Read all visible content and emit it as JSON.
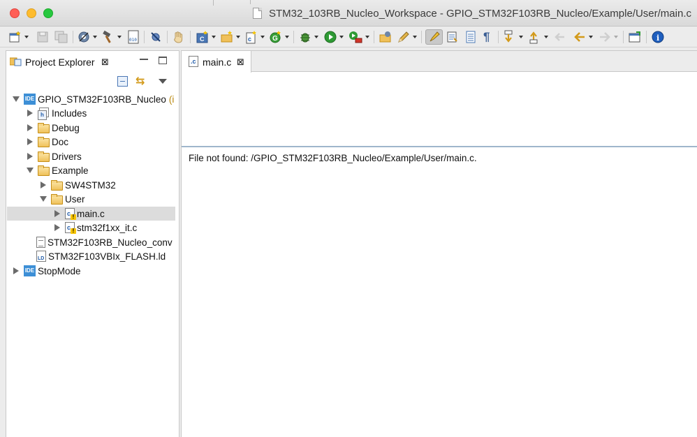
{
  "window": {
    "title": "STM32_103RB_Nucleo_Workspace - GPIO_STM32F103RB_Nucleo/Example/User/main.c"
  },
  "toolbar": {
    "buttons": [
      "new",
      "save",
      "save-all",
      "build-target",
      "build",
      "debug-config",
      "skip-breakpoints",
      "step",
      "new-c-project",
      "new-source-folder",
      "new-class",
      "run-external",
      "debug",
      "run",
      "run-last",
      "open-type",
      "open-task",
      "highlight",
      "mark-occurrences",
      "show-whitespace",
      "pilcrow",
      "next-annotation",
      "prev-annotation",
      "back",
      "forward",
      "perspective",
      "info"
    ]
  },
  "left_view": {
    "title": "Project Explorer",
    "close_glyph": "⊠",
    "tree": [
      {
        "label": "GPIO_STM32F103RB_Nucleo",
        "suffix": "(i",
        "level": 0,
        "expand": "down",
        "icon": "ide-project-icon"
      },
      {
        "label": "Includes",
        "level": 1,
        "expand": "right",
        "icon": "includes-icon"
      },
      {
        "label": "Debug",
        "level": 1,
        "expand": "right",
        "icon": "folder-icon"
      },
      {
        "label": "Doc",
        "level": 1,
        "expand": "right",
        "icon": "folder-icon"
      },
      {
        "label": "Drivers",
        "level": 1,
        "expand": "right",
        "icon": "folder-icon"
      },
      {
        "label": "Example",
        "level": 1,
        "expand": "down",
        "icon": "folder-open-icon"
      },
      {
        "label": "SW4STM32",
        "level": 2,
        "expand": "right",
        "icon": "folder-icon"
      },
      {
        "label": "User",
        "level": 2,
        "expand": "down",
        "icon": "folder-open-icon"
      },
      {
        "label": "main.c",
        "level": 3,
        "expand": "right",
        "icon": "c-file-warning-icon",
        "selected": true
      },
      {
        "label": "stm32f1xx_it.c",
        "level": 3,
        "expand": "right",
        "icon": "c-file-warning-icon"
      },
      {
        "label": "STM32F103RB_Nucleo_conv",
        "level": 1,
        "expand": "none",
        "icon": "text-file-icon"
      },
      {
        "label": "STM32F103VBIx_FLASH.ld",
        "level": 1,
        "expand": "none",
        "icon": "ld-file-icon"
      },
      {
        "label": "StopMode",
        "level": 0,
        "expand": "right",
        "icon": "ide-project-icon"
      }
    ]
  },
  "editor": {
    "tab_label": "main.c",
    "tab_close_glyph": "⊠",
    "message": "File not found: /GPIO_STM32F103RB_Nucleo/Example/User/main.c."
  }
}
